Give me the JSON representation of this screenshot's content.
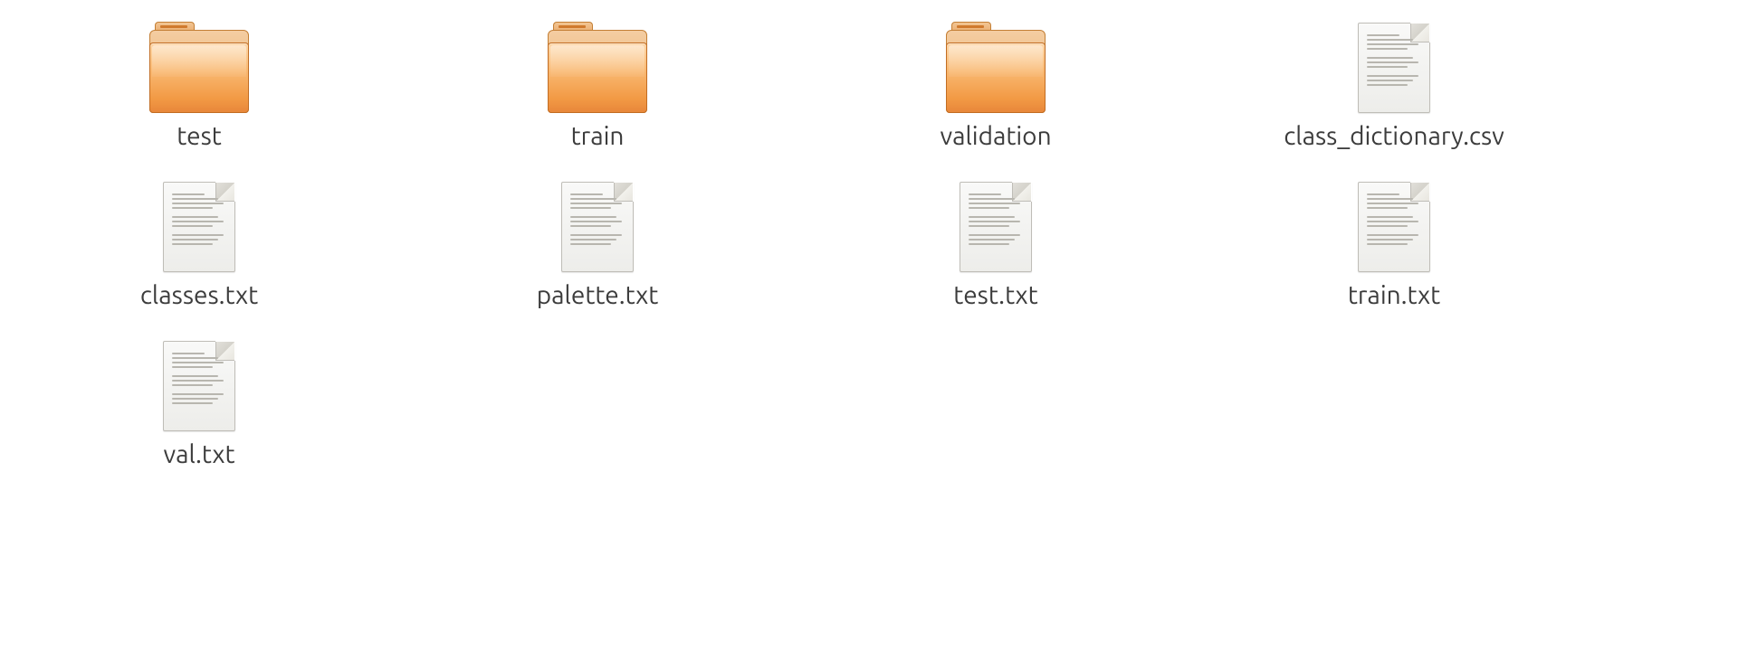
{
  "items": [
    {
      "name": "test",
      "kind": "folder"
    },
    {
      "name": "train",
      "kind": "folder"
    },
    {
      "name": "validation",
      "kind": "folder"
    },
    {
      "name": "class_dictionary.csv",
      "kind": "textfile"
    },
    {
      "name": "classes.txt",
      "kind": "textfile"
    },
    {
      "name": "palette.txt",
      "kind": "textfile"
    },
    {
      "name": "test.txt",
      "kind": "textfile"
    },
    {
      "name": "train.txt",
      "kind": "textfile"
    },
    {
      "name": "val.txt",
      "kind": "textfile"
    }
  ]
}
